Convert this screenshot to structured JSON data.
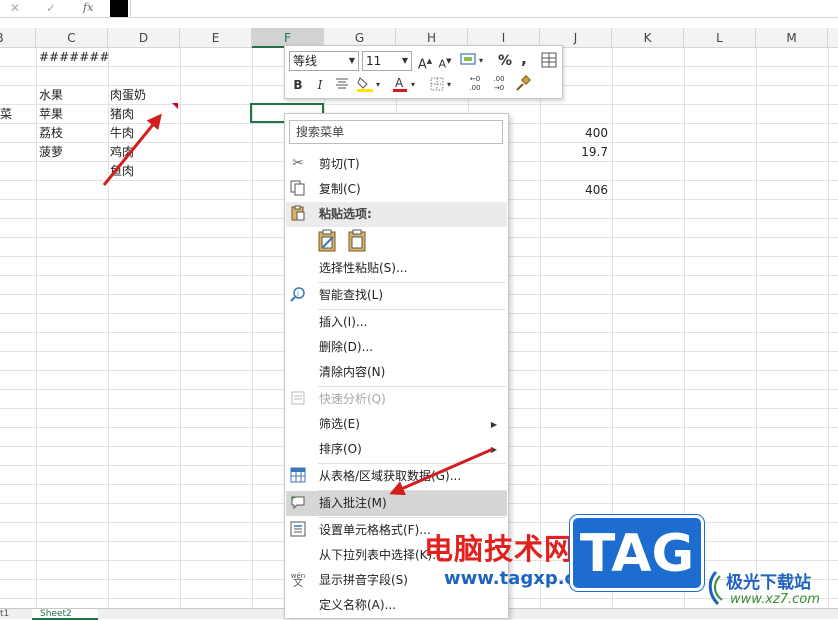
{
  "formula_bar": {
    "cancel_icon": "✕",
    "confirm_icon": "✓",
    "fx_label": "fx"
  },
  "columns": [
    "B",
    "C",
    "D",
    "E",
    "F",
    "G",
    "H",
    "I",
    "J",
    "K",
    "L",
    "M"
  ],
  "selected_column": "F",
  "cells": {
    "c_hash": "#######",
    "c_fruit": "水果",
    "d_meat_egg_milk": "肉蛋奶",
    "b_veg_partial": "菜",
    "c_apple": "苹果",
    "d_pork": "猪肉",
    "c_lychee": "荔枝",
    "d_beef": "牛肉",
    "c_pineapple": "菠萝",
    "d_chicken": "鸡肉",
    "d_fish": "鱼肉",
    "j_400": "400",
    "j_19_7": "19.7",
    "j_406": "406"
  },
  "mini_toolbar": {
    "font_name": "等线",
    "font_size": "11",
    "grow_font": "A",
    "shrink_font": "A",
    "percent": "%",
    "comma": ",",
    "bold": "B",
    "italic": "I",
    "inc_decimal": ".00",
    "dec_decimal": ".00",
    "inc_decimal_top": "←0",
    "dec_decimal_top": "→0"
  },
  "context_menu": {
    "search_placeholder": "搜索菜单",
    "items": [
      {
        "label": "剪切(T)"
      },
      {
        "label": "复制(C)"
      },
      {
        "label": "粘贴选项:"
      },
      {
        "label": "选择性粘贴(S)..."
      },
      {
        "label": "智能查找(L)"
      },
      {
        "label": "插入(I)..."
      },
      {
        "label": "删除(D)..."
      },
      {
        "label": "清除内容(N)"
      },
      {
        "label": "快速分析(Q)"
      },
      {
        "label": "筛选(E)"
      },
      {
        "label": "排序(O)"
      },
      {
        "label": "从表格/区域获取数据(G)..."
      },
      {
        "label": "插入批注(M)"
      },
      {
        "label": "设置单元格格式(F)..."
      },
      {
        "label": "从下拉列表中选择(K)..."
      },
      {
        "label": "显示拼音字段(S)"
      },
      {
        "label": "定义名称(A)..."
      }
    ],
    "pinyin_icon_top": "wén",
    "pinyin_icon_bottom": "文"
  },
  "sheet_tab": {
    "left_edge": "t1",
    "name": "Sheet2"
  },
  "watermark": {
    "site_name": "电脑技术网",
    "site_url": "www.tagxp.com",
    "logo_text": "TAG",
    "brand_name": "极光下载站",
    "brand_url": "www.xz7.com"
  },
  "colors": {
    "excel_green": "#217346",
    "arrow_red": "#d11d1d",
    "watermark_red": "#e2201e",
    "watermark_blue": "#1e63c0"
  }
}
